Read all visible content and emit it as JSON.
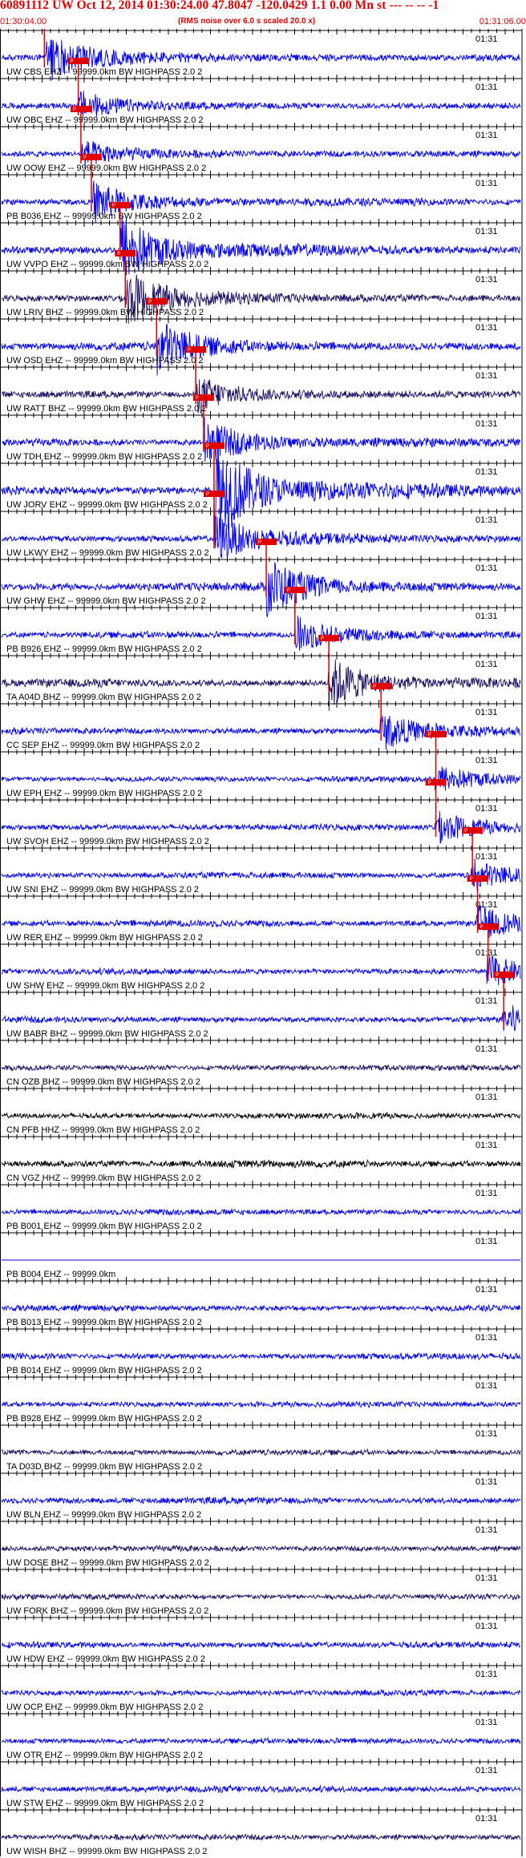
{
  "header": {
    "title": "60891112 UW Oct 12, 2014 01:30:24.00   47.8047 -120.0429  1.1 0.00 Mn st --- -- --  -1",
    "start_time": "01:30:04.00",
    "note": "(RMS noise over 6.0 s scaled 20.0 x)",
    "end_time": "01:31:06.00"
  },
  "colors": {
    "title": "#e00000",
    "trace_main": "#0000ee",
    "trace_dark": "#1a1060",
    "trace_black": "#000000",
    "pick_box": "#e00000",
    "pick_line": "#e00000"
  },
  "chart_data": {
    "type": "seismogram",
    "time_start": "01:30:04.00",
    "time_end": "01:31:06.00",
    "minute_mark": "01:31",
    "pick_label": "P",
    "traces": [
      {
        "label": "UW CBS EHZ -- 99999.0km BW  HIGHPASS  2.0  2",
        "pick": 0.085,
        "color": "blue",
        "amp": 0.55
      },
      {
        "label": "UW OBC EHZ -- 99999.0km BW  HIGHPASS  2.0  2",
        "pick": 0.15,
        "color": "blue",
        "amp": 0.35
      },
      {
        "label": "UW OOW EHZ -- 99999.0km BW  HIGHPASS  2.0  2",
        "pick": 0.155,
        "color": "blue",
        "amp": 0.35
      },
      {
        "label": "PB B036 EHZ -- 99999.0km BW  HIGHPASS  2.0  2",
        "pick": 0.175,
        "color": "blue",
        "amp": 0.5
      },
      {
        "label": "UW VVPO EHZ -- 99999.0km BW  HIGHPASS  2.0  2",
        "pick": 0.23,
        "color": "blue",
        "amp": 0.75
      },
      {
        "label": "UW LRIV BHZ -- 99999.0km BW  HIGHPASS  2.0  2",
        "pick": 0.24,
        "color": "dark",
        "amp": 0.6
      },
      {
        "label": "UW OSD EHZ -- 99999.0km BW  HIGHPASS  2.0  2",
        "pick": 0.3,
        "color": "blue",
        "amp": 0.6
      },
      {
        "label": "UW RATT BHZ -- 99999.0km BW  HIGHPASS  2.0  2",
        "pick": 0.375,
        "color": "dark",
        "amp": 0.45
      },
      {
        "label": "UW TDH EHZ -- 99999.0km BW  HIGHPASS  2.0  2",
        "pick": 0.39,
        "color": "blue",
        "amp": 0.55
      },
      {
        "label": "UW JORV EHZ -- 99999.0km BW  HIGHPASS  2.0  2",
        "pick": 0.41,
        "color": "blue",
        "amp": 1.0
      },
      {
        "label": "UW LKWY EHZ -- 99999.0km BW  HIGHPASS  2.0  2",
        "pick": 0.41,
        "color": "blue",
        "amp": 0.55
      },
      {
        "label": "UW GHW EHZ -- 99999.0km BW  HIGHPASS  2.0  2",
        "pick": 0.51,
        "color": "blue",
        "amp": 0.65
      },
      {
        "label": "PB B926 EHZ -- 99999.0km BW  HIGHPASS  2.0  2",
        "pick": 0.565,
        "color": "blue",
        "amp": 0.45
      },
      {
        "label": "TA A04D BHZ -- 99999.0km BW  HIGHPASS  2.0  2",
        "pick": 0.63,
        "color": "dark",
        "amp": 0.6
      },
      {
        "label": "CC SEP EHZ -- 99999.0km BW  HIGHPASS  2.0  2",
        "pick": 0.73,
        "color": "blue",
        "amp": 0.45
      },
      {
        "label": "UW EPH EHZ -- 99999.0km BW  HIGHPASS  2.0  2",
        "pick": 0.835,
        "color": "blue",
        "amp": 0.35
      },
      {
        "label": "UW SVOH EHZ -- 99999.0km BW  HIGHPASS  2.0  2",
        "pick": 0.835,
        "color": "blue",
        "amp": 0.4
      },
      {
        "label": "UW SNI EHZ -- 99999.0km BW  HIGHPASS  2.0  2",
        "pick": 0.905,
        "color": "blue",
        "amp": 0.4
      },
      {
        "label": "UW RER EHZ -- 99999.0km BW  HIGHPASS  2.0  2",
        "pick": 0.915,
        "color": "blue",
        "amp": 0.45
      },
      {
        "label": "UW SHW EHZ -- 99999.0km BW  HIGHPASS  2.0  2",
        "pick": 0.935,
        "color": "blue",
        "amp": 0.4
      },
      {
        "label": "UW BABR BHZ -- 99999.0km BW  HIGHPASS  2.0  2",
        "pick": 0.965,
        "color": "blue",
        "amp": 0.4
      },
      {
        "label": "CN OZB BHZ -- 99999.0km BW  HIGHPASS  2.0  2",
        "pick": null,
        "color": "dark",
        "amp": 0.35
      },
      {
        "label": "CN PFB HHZ -- 99999.0km BW  HIGHPASS  2.0  2",
        "pick": null,
        "color": "black",
        "amp": 0.35
      },
      {
        "label": "CN VGZ HHZ -- 99999.0km BW  HIGHPASS  2.0  2",
        "pick": null,
        "color": "black",
        "amp": 0.55
      },
      {
        "label": "PB B001 EHZ -- 99999.0km BW  HIGHPASS  2.0  2",
        "pick": null,
        "color": "blue",
        "amp": 0.35
      },
      {
        "label": "PB B004 EHZ -- 99999.0km",
        "pick": null,
        "color": "blue",
        "amp": 0.0
      },
      {
        "label": "PB B013 EHZ -- 99999.0km BW  HIGHPASS  2.0  2",
        "pick": null,
        "color": "blue",
        "amp": 0.4
      },
      {
        "label": "PB B014 EHZ -- 99999.0km BW  HIGHPASS  2.0  2",
        "pick": null,
        "color": "blue",
        "amp": 0.4
      },
      {
        "label": "PB B928 EHZ -- 99999.0km BW  HIGHPASS  2.0  2",
        "pick": null,
        "color": "blue",
        "amp": 0.35
      },
      {
        "label": "TA D03D BHZ -- 99999.0km BW  HIGHPASS  2.0  2",
        "pick": null,
        "color": "dark",
        "amp": 0.35
      },
      {
        "label": "UW BLN EHZ -- 99999.0km BW  HIGHPASS  2.0  2",
        "pick": null,
        "color": "blue",
        "amp": 0.45
      },
      {
        "label": "UW DOSE BHZ -- 99999.0km BW  HIGHPASS  2.0  2",
        "pick": null,
        "color": "dark",
        "amp": 0.35
      },
      {
        "label": "UW FORK BHZ -- 99999.0km BW  HIGHPASS  2.0  2",
        "pick": null,
        "color": "dark",
        "amp": 0.35
      },
      {
        "label": "UW HDW EHZ -- 99999.0km BW  HIGHPASS  2.0  2",
        "pick": null,
        "color": "blue",
        "amp": 0.4
      },
      {
        "label": "UW OCP EHZ -- 99999.0km BW  HIGHPASS  2.0  2",
        "pick": null,
        "color": "blue",
        "amp": 0.35
      },
      {
        "label": "UW OTR EHZ -- 99999.0km BW  HIGHPASS  2.0  2",
        "pick": null,
        "color": "blue",
        "amp": 0.35
      },
      {
        "label": "UW STW EHZ -- 99999.0km BW  HIGHPASS  2.0  2",
        "pick": null,
        "color": "blue",
        "amp": 0.45
      },
      {
        "label": "UW WISH BHZ -- 99999.0km BW  HIGHPASS  2.0  2",
        "pick": null,
        "color": "dark",
        "amp": 0.35
      }
    ]
  }
}
